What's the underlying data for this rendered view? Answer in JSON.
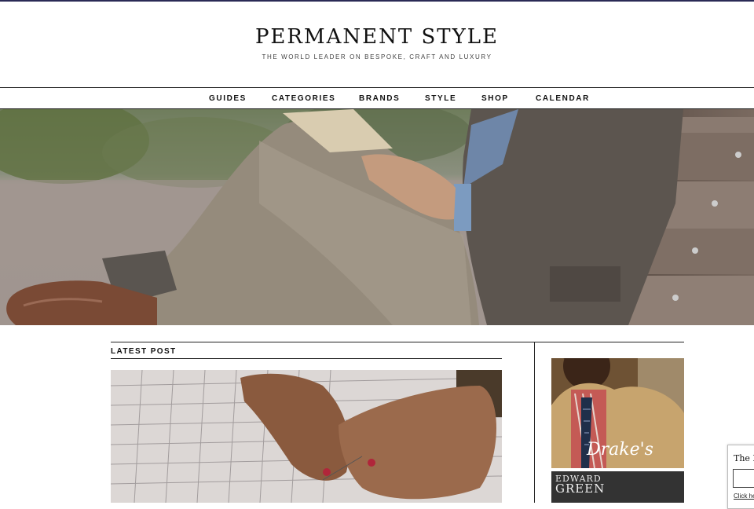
{
  "site": {
    "title": "PERMANENT STYLE",
    "tagline": "THE WORLD LEADER ON BESPOKE, CRAFT AND LUXURY"
  },
  "nav": {
    "items": [
      {
        "label": "GUIDES"
      },
      {
        "label": "CATEGORIES"
      },
      {
        "label": "BRANDS"
      },
      {
        "label": "STYLE"
      },
      {
        "label": "SHOP"
      },
      {
        "label": "CALENDAR"
      }
    ]
  },
  "hero": {
    "image": "man-seated-on-bench-reading"
  },
  "latest": {
    "heading": "LATEST POST",
    "image": "hands-sewing-check-shirt"
  },
  "sidebar": {
    "ads": [
      {
        "brand": "Drake's",
        "image": "man-in-tan-jacket-and-tie"
      },
      {
        "brand_line1": "EDWARD",
        "brand_line2": "GREEN"
      }
    ]
  },
  "popup": {
    "text": "The P",
    "link": "Click he"
  },
  "colors": {
    "accent_top": "#2a2a55",
    "text": "#111111",
    "rule": "#222222"
  }
}
